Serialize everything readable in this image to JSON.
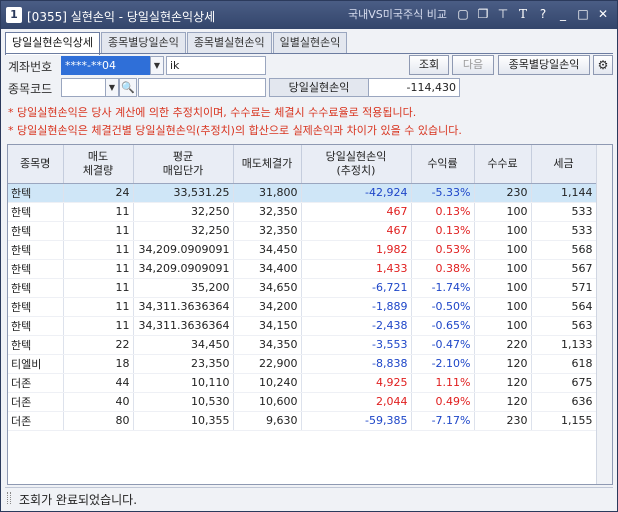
{
  "window": {
    "number": "1",
    "title": "[0355] 실현손익 - 당일실현손익상세",
    "link": "국내VS미국주식 비교"
  },
  "tabs": [
    {
      "label": "당일실현손익상세",
      "active": true
    },
    {
      "label": "종목별당일손익",
      "active": false
    },
    {
      "label": "종목별실현손익",
      "active": false
    },
    {
      "label": "일별실현손익",
      "active": false
    }
  ],
  "account": {
    "label": "계좌번호",
    "value": "****-**04",
    "name": "ik"
  },
  "buttons": {
    "query": "조회",
    "next": "다음",
    "by_stock": "종목별당일손익"
  },
  "stock": {
    "label": "종목코드",
    "value": "",
    "name": ""
  },
  "summary": {
    "label": "당일실현손익",
    "value": "-114,430"
  },
  "notes": [
    "* 당일실현손익은 당사 계산에 의한 추정치이며, 수수료는 체결시 수수료율로 적용됩니다.",
    "* 당일실현손익은 체결건별 당일실현손익(추정치)의 합산으로 실제손익과 차이가 있을 수 있습니다."
  ],
  "table": {
    "headers": [
      "종목명",
      "매도\n체결량",
      "평균\n매입단가",
      "매도체결가",
      "당일실현손익\n(추정치)",
      "수익률",
      "수수료",
      "세금"
    ],
    "rows": [
      [
        "한텍",
        "24",
        "33,531.25",
        "31,800",
        "-42,924",
        "-5.33%",
        "230",
        "1,144"
      ],
      [
        "한텍",
        "11",
        "32,250",
        "32,350",
        "467",
        "0.13%",
        "100",
        "533"
      ],
      [
        "한텍",
        "11",
        "32,250",
        "32,350",
        "467",
        "0.13%",
        "100",
        "533"
      ],
      [
        "한텍",
        "11",
        "34,209.0909091",
        "34,450",
        "1,982",
        "0.53%",
        "100",
        "568"
      ],
      [
        "한텍",
        "11",
        "34,209.0909091",
        "34,400",
        "1,433",
        "0.38%",
        "100",
        "567"
      ],
      [
        "한텍",
        "11",
        "35,200",
        "34,650",
        "-6,721",
        "-1.74%",
        "100",
        "571"
      ],
      [
        "한텍",
        "11",
        "34,311.3636364",
        "34,200",
        "-1,889",
        "-0.50%",
        "100",
        "564"
      ],
      [
        "한텍",
        "11",
        "34,311.3636364",
        "34,150",
        "-2,438",
        "-0.65%",
        "100",
        "563"
      ],
      [
        "한텍",
        "22",
        "34,450",
        "34,350",
        "-3,553",
        "-0.47%",
        "220",
        "1,133"
      ],
      [
        "티엘비",
        "18",
        "23,350",
        "22,900",
        "-8,838",
        "-2.10%",
        "120",
        "618"
      ],
      [
        "더존",
        "44",
        "10,110",
        "10,240",
        "4,925",
        "1.11%",
        "120",
        "675"
      ],
      [
        "더존",
        "40",
        "10,530",
        "10,600",
        "2,044",
        "0.49%",
        "120",
        "636"
      ],
      [
        "더존",
        "80",
        "10,355",
        "9,630",
        "-59,385",
        "-7.17%",
        "230",
        "1,155"
      ]
    ]
  },
  "status": "조회가 완료되었습니다.",
  "colors": {
    "positive": "#e01e1e",
    "negative": "#1e46c8",
    "selected_row": "#cfe6f7",
    "note": "#d8341f"
  }
}
